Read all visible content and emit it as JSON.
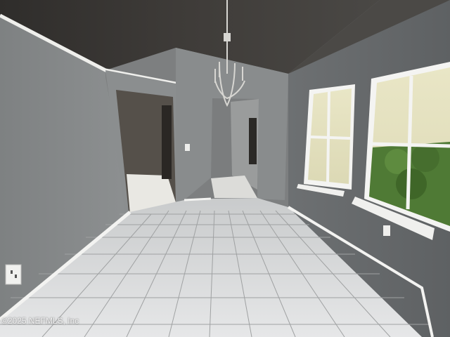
{
  "photo": {
    "watermark": "©2025 NEFMLS, Inc",
    "colors": {
      "wall": "#8c8f8f",
      "ceiling": "#3a3835",
      "floor": "#d8dadb",
      "trim": "#f2f2f0",
      "window_foliage": "#4f7a35"
    }
  }
}
